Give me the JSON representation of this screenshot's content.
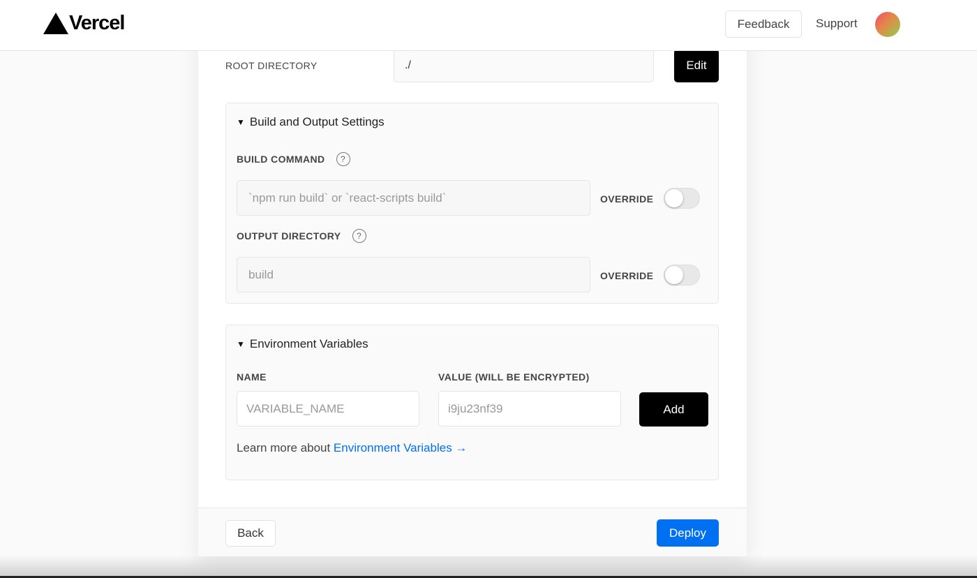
{
  "header": {
    "brand": "Vercel",
    "feedback_label": "Feedback",
    "support_label": "Support",
    "logo_icon": "triangle-logo-icon",
    "avatar_gradient": [
      "#f04e6a",
      "#e3894a",
      "#8cd04d"
    ]
  },
  "root_directory": {
    "label": "ROOT DIRECTORY",
    "value": "./",
    "edit_label": "Edit"
  },
  "build_settings": {
    "title": "Build and Output Settings",
    "build_command": {
      "label": "BUILD COMMAND",
      "placeholder": "`npm run build` or `react-scripts build`",
      "override_label": "OVERRIDE",
      "override_on": false
    },
    "output_directory": {
      "label": "OUTPUT DIRECTORY",
      "placeholder": "build",
      "override_label": "OVERRIDE",
      "override_on": false
    }
  },
  "env_vars": {
    "title": "Environment Variables",
    "name_label": "NAME",
    "name_placeholder": "VARIABLE_NAME",
    "value_label": "VALUE (WILL BE ENCRYPTED)",
    "value_placeholder": "i9ju23nf39",
    "add_label": "Add",
    "learn_more_prefix": "Learn more about ",
    "learn_more_link": "Environment Variables →"
  },
  "footer": {
    "back_label": "Back",
    "deploy_label": "Deploy"
  },
  "colors": {
    "accent": "#0070f3",
    "primary_button": "#000000"
  }
}
